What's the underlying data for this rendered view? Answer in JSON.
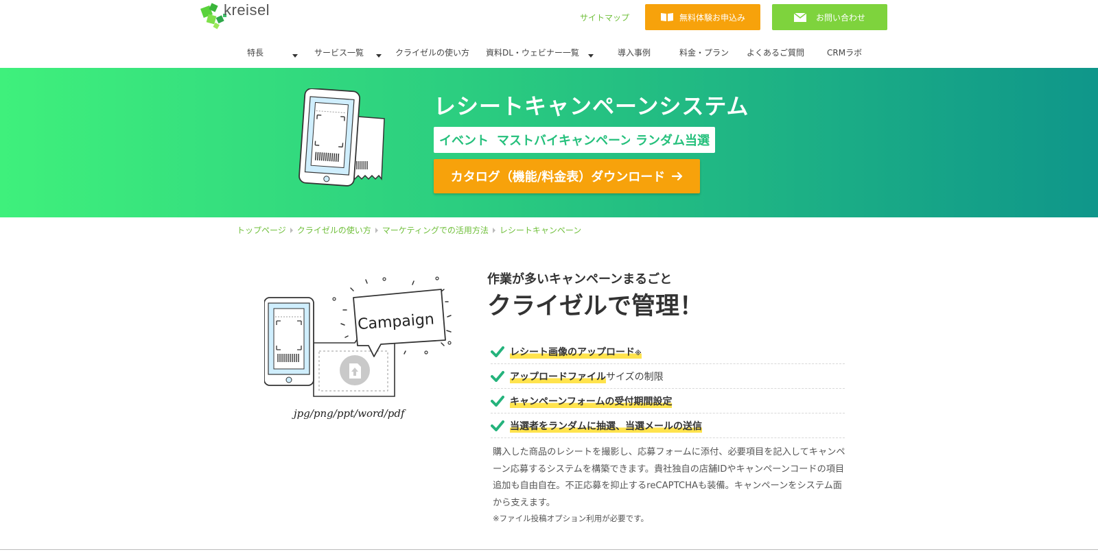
{
  "header": {
    "logo_text": "kreisel",
    "sitemap_label": "サイトマップ",
    "trial_button_label": "無料体験お申込み",
    "contact_button_label": "お問い合わせ",
    "brand_green": "#7ed33d",
    "brand_orange": "#f7a20b"
  },
  "nav": {
    "items": [
      {
        "label": "特長",
        "has_dropdown": true
      },
      {
        "label": "サービス一覧",
        "has_dropdown": true
      },
      {
        "label": "クライゼルの使い方",
        "has_dropdown": false
      },
      {
        "label": "資料DL・ウェビナー一覧",
        "has_dropdown": true
      },
      {
        "label": "導入事例",
        "has_dropdown": false
      },
      {
        "label": "料金・プラン",
        "has_dropdown": false
      },
      {
        "label": "よくあるご質問",
        "has_dropdown": false
      },
      {
        "label": "CRMラボ",
        "has_dropdown": false
      }
    ]
  },
  "hero": {
    "title": "レシートキャンペーンシステム",
    "tags": [
      "イベント",
      "マストバイキャンペーン",
      "ランダム当選"
    ],
    "catalog_button_label": "カタログ（機能/料金表）ダウンロード",
    "gradient_start": "#3ff07c",
    "gradient_end": "#0f968a"
  },
  "breadcrumb": {
    "items": [
      "トップページ",
      "クライゼルの使い方",
      "マーケティングでの活用方法",
      "レシートキャンペーン"
    ]
  },
  "content": {
    "illustration": {
      "bubble_text": "Campaign",
      "caption": "jpg/png/ppt/word/pdf"
    },
    "sub_heading": "作業が多いキャンペーンまるごと",
    "main_heading": "クライゼルで管理！",
    "features": [
      {
        "highlight": "レシート画像のアップロード",
        "plain": "",
        "mark": "※"
      },
      {
        "highlight": "アップロードファイル",
        "plain": "サイズの制限",
        "mark": ""
      },
      {
        "highlight": "キャンペーンフォームの受付期間設定",
        "plain": "",
        "mark": ""
      },
      {
        "highlight": "当選者をランダムに抽選、当選メールの送信",
        "plain": "",
        "mark": ""
      }
    ],
    "description": "購入した商品のレシートを撮影し、応募フォームに添付、必要項目を記入してキャンペーン応募するシステムを構築できます。貴社独自の店舗IDやキャンペーンコードの項目追加も自由自在。不正応募を抑止するreCAPTCHAも装備。キャンペーンをシステム面から支えます。",
    "footnote": "※ファイル投稿オプション利用が必要です。"
  }
}
